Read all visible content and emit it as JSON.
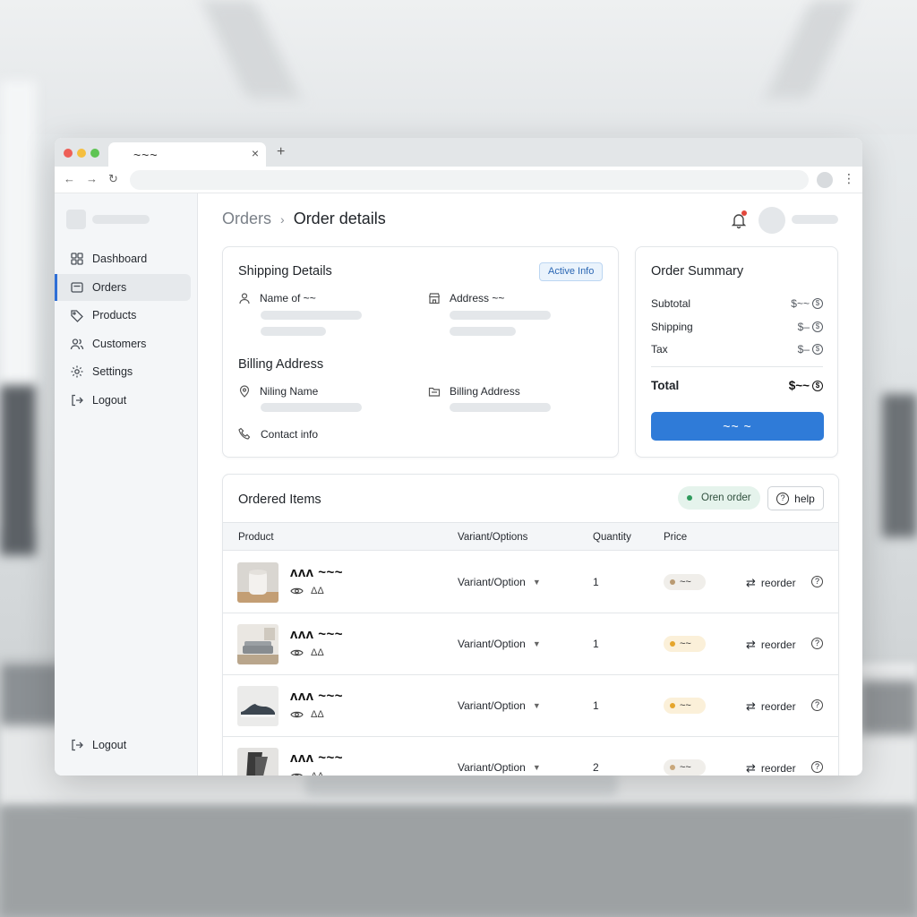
{
  "browser": {
    "tab_title": "~~~",
    "tab_close": "×",
    "new_tab": "+",
    "back_icon": "←",
    "forward_icon": "→",
    "reload_icon": "↻",
    "menu_icon": "⋮"
  },
  "sidebar": {
    "items": [
      {
        "label": "Dashboard",
        "icon": "grid-icon"
      },
      {
        "label": "Orders",
        "icon": "orders-icon",
        "active": true
      },
      {
        "label": "Products",
        "icon": "tag-icon"
      },
      {
        "label": "Customers",
        "icon": "users-icon"
      },
      {
        "label": "Settings",
        "icon": "gear-icon"
      },
      {
        "label": "Logout",
        "icon": "logout-icon"
      }
    ],
    "bottom_logout": "Logout"
  },
  "breadcrumb": {
    "parent": "Orders",
    "separator": "›",
    "current": "Order details"
  },
  "shipping": {
    "title": "Shipping Details",
    "badge": "Active Info",
    "name_label": "Name of ~~",
    "address_label": "Address ~~",
    "billing_title": "Billing Address",
    "billing_name_label": "Niling Name",
    "billing_address_label": "Billing Address",
    "contact_label": "Contact info"
  },
  "summary": {
    "title": "Order Summary",
    "rows": [
      {
        "label": "Subtotal",
        "value": "$~~"
      },
      {
        "label": "Shipping",
        "value": "$–"
      },
      {
        "label": "Tax",
        "value": "$–"
      }
    ],
    "total_label": "Total",
    "total_value": "$~~",
    "coin_symbol": "$",
    "button_label": "~~ ~"
  },
  "items": {
    "title": "Ordered Items",
    "open_order": "Oren order",
    "help": "help",
    "columns": [
      "Product",
      "Variant/Options",
      "Quantity",
      "Price"
    ],
    "rows": [
      {
        "name": "ᴧᴧᴧ ~~~",
        "meta": "ΔΔ",
        "variant": "Variant/Option",
        "qty": "1",
        "price": "~~",
        "price_color": "#f0eeea",
        "dot": "#b99a72",
        "thumb": "speaker",
        "reorder": "reorder"
      },
      {
        "name": "ᴧᴧᴧ ~~~",
        "meta": "ΔΔ",
        "variant": "Variant/Option",
        "qty": "1",
        "price": "~~",
        "price_color": "#fbf0d9",
        "dot": "#e5a52c",
        "thumb": "sofa",
        "reorder": "reorder"
      },
      {
        "name": "ᴧᴧᴧ ~~~",
        "meta": "ΔΔ",
        "variant": "Variant/Option",
        "qty": "1",
        "price": "~~",
        "price_color": "#fbf0d9",
        "dot": "#e5a52c",
        "thumb": "shoe",
        "reorder": "reorder"
      },
      {
        "name": "ᴧᴧᴧ ~~~",
        "meta": "ΔΔ",
        "variant": "Variant/Option",
        "qty": "2",
        "price": "~~",
        "price_color": "#f0eeea",
        "dot": "#c9a87c",
        "thumb": "chair",
        "reorder": "reorder"
      }
    ]
  },
  "colors": {
    "accent": "#2f7bd8",
    "badge_info": "#eaf3fc",
    "open_order": "#e5f3ec"
  }
}
